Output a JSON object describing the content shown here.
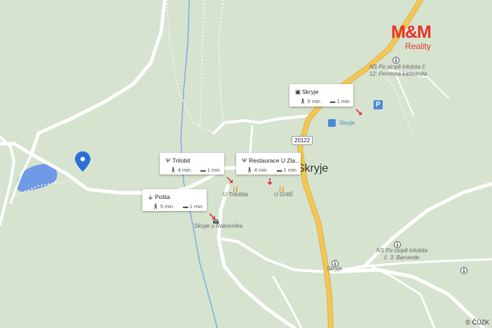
{
  "brand": {
    "logo_text": "M&M",
    "logo_sub": "Reality"
  },
  "copyright": "© ČÚZK",
  "town_label": "Skryje",
  "road_number": "20122",
  "colors": {
    "land": "#d6e3cf",
    "road": "#ffffff",
    "main_road": "#f4c652",
    "stream": "#7faee6",
    "water": "#6e9ae8",
    "pin": "#2b6fd6",
    "brand": "#e8332a"
  },
  "map_labels": [
    {
      "text": "NS Po stopě trilobita č.",
      "icon": "info-icon"
    },
    {
      "text": "12: Permská katastrofa"
    },
    {
      "text": "Skryje",
      "icon": "bus-stop-icon"
    },
    {
      "text": "U Trilobita",
      "icon": "restaurant-icon"
    },
    {
      "text": "U Grillů",
      "icon": "restaurant-icon"
    },
    {
      "text": "Skryje u Rakovníka",
      "icon": "post-icon"
    },
    {
      "text": "NS Po stopě trilobita",
      "icon": "info-icon"
    },
    {
      "text": "č. 3: Barrande"
    },
    {
      "text": "Skryje",
      "icon": "info-icon"
    }
  ],
  "place_cards": [
    {
      "name": "Skryje",
      "icon": "bus-icon",
      "walk": "5 min",
      "drive": "1 min"
    },
    {
      "name": "Trilobit",
      "icon": "restaurant-icon",
      "walk": "4 min",
      "drive": "1 min"
    },
    {
      "name": "Restaurace U Zla...",
      "icon": "restaurant-icon",
      "walk": "4 min",
      "drive": "1 min"
    },
    {
      "name": "Pošta",
      "icon": "post-office-icon",
      "walk": "5 min",
      "drive": "1 min"
    }
  ],
  "icons": {
    "parking": "P",
    "pin": "location-pin-icon"
  }
}
